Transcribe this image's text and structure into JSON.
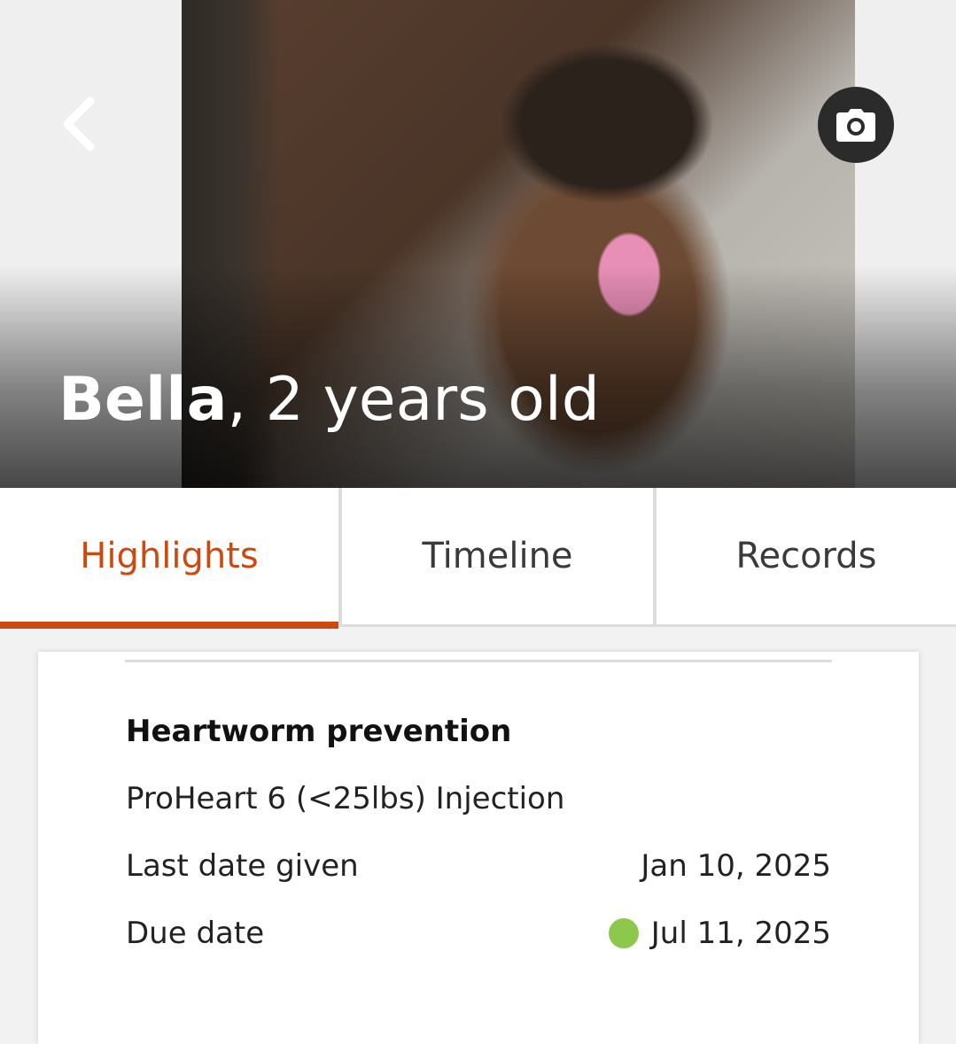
{
  "header": {
    "pet_name": "Bella",
    "age_text": ", 2 years old",
    "back_icon": "chevron-left-icon",
    "camera_icon": "camera-icon"
  },
  "tabs": [
    {
      "label": "Highlights",
      "active": true
    },
    {
      "label": "Timeline",
      "active": false
    },
    {
      "label": "Records",
      "active": false
    }
  ],
  "card": {
    "title": "Heartworm prevention",
    "product": "ProHeart 6 (<25lbs) Injection",
    "last_date_label": "Last date given",
    "last_date_value": "Jan 10, 2025",
    "due_date_label": "Due date",
    "due_date_value": "Jul 11, 2025",
    "status_color": "#8cc84b"
  },
  "colors": {
    "accent": "#cc4a10"
  }
}
